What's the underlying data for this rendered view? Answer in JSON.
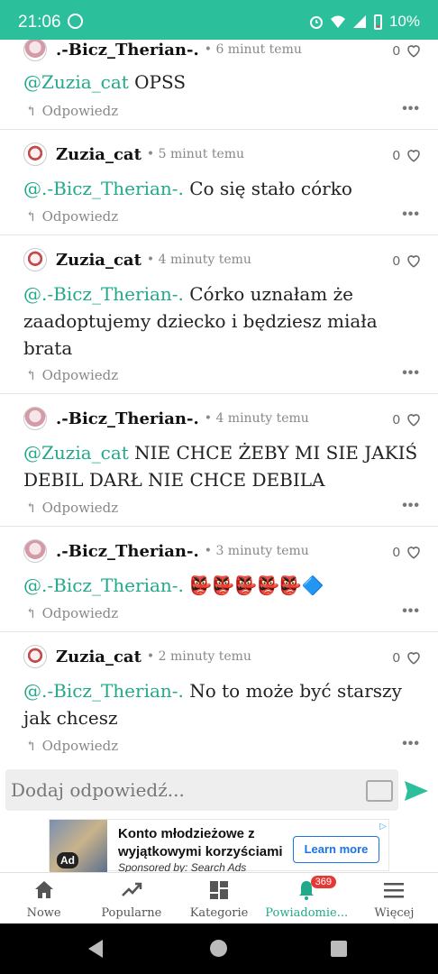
{
  "status_bar": {
    "time": "21:06",
    "battery": "10%"
  },
  "comments": [
    {
      "author": ".-Bicz_Therian-.",
      "avatar": "bicz",
      "time": "6 minut temu",
      "likes": "0",
      "mention": "@Zuzia_cat",
      "text": "OPSS",
      "reply": "Odpowiedz"
    },
    {
      "author": "Zuzia_cat",
      "avatar": "zuzia",
      "time": "5 minut temu",
      "likes": "0",
      "mention": "@.-Bicz_Therian-.",
      "text": "Co się stało córko",
      "reply": "Odpowiedz"
    },
    {
      "author": "Zuzia_cat",
      "avatar": "zuzia",
      "time": "4 minuty temu",
      "likes": "0",
      "mention": "@.-Bicz_Therian-.",
      "text": "Córko uznałam że zaadoptujemy dziecko i będziesz miała brata",
      "reply": "Odpowiedz"
    },
    {
      "author": ".-Bicz_Therian-.",
      "avatar": "bicz",
      "time": "4 minuty temu",
      "likes": "0",
      "mention": "@Zuzia_cat",
      "text": "NIE CHCE ŻEBY MI SIE JAKIŚ DEBIL DARŁ NIE CHCE DEBILA",
      "reply": "Odpowiedz"
    },
    {
      "author": ".-Bicz_Therian-.",
      "avatar": "bicz",
      "time": "3 minuty temu",
      "likes": "0",
      "mention": "@.-Bicz_Therian-.",
      "text": "👺👺👺👺👺🔷",
      "reply": "Odpowiedz"
    },
    {
      "author": "Zuzia_cat",
      "avatar": "zuzia",
      "time": "2 minuty temu",
      "likes": "0",
      "mention": "@.-Bicz_Therian-.",
      "text": "No to może być starszy jak chcesz",
      "reply": "Odpowiedz"
    }
  ],
  "reply_input": {
    "placeholder": "Dodaj odpowiedź..."
  },
  "ad": {
    "title": "Konto młodzieżowe z wyjątkowymi korzyściami",
    "sponsor": "Sponsored by: Search Ads",
    "cta": "Learn more",
    "badge": "Ad"
  },
  "tabs": [
    {
      "label": "Nowe",
      "icon": "home-icon"
    },
    {
      "label": "Popularne",
      "icon": "trending-icon"
    },
    {
      "label": "Kategorie",
      "icon": "grid-icon"
    },
    {
      "label": "Powiadomie...",
      "icon": "bell-icon",
      "badge": "369",
      "active": true
    },
    {
      "label": "Więcej",
      "icon": "menu-icon"
    }
  ],
  "colors": {
    "accent": "#2bbf9c",
    "mention": "#22a98b",
    "badge": "#e53935"
  }
}
